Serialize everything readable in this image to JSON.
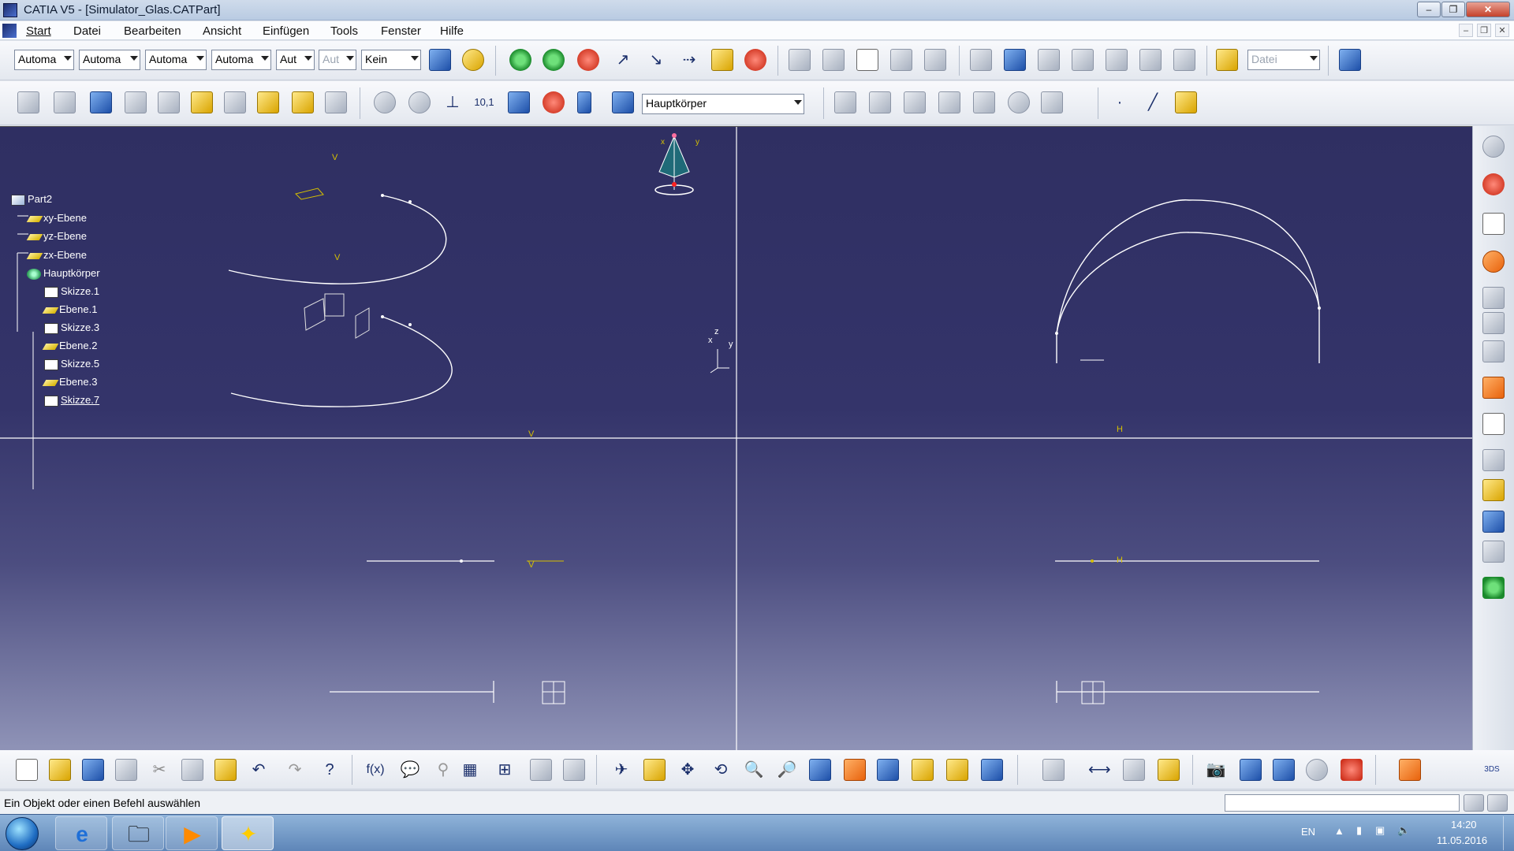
{
  "window": {
    "title": "CATIA V5 - [Simulator_Glas.CATPart]",
    "controls": [
      "–",
      "❐",
      "✕"
    ]
  },
  "menu": {
    "items": [
      "Start",
      "Datei",
      "Bearbeiten",
      "Ansicht",
      "Einfügen",
      "Tools",
      "Fenster",
      "Hilfe"
    ]
  },
  "toolbar1": {
    "combos": [
      "Automa",
      "Automa",
      "Automa",
      "Automa",
      "Aut",
      "Aut",
      "Kein"
    ],
    "file_combo": "Datei"
  },
  "toolbar2": {
    "body_combo": "Hauptkörper"
  },
  "tree": {
    "root": "Part2",
    "items": [
      "xy-Ebene",
      "yz-Ebene",
      "zx-Ebene",
      "Hauptkörper",
      "Skizze.1",
      "Ebene.1",
      "Skizze.3",
      "Ebene.2",
      "Skizze.5",
      "Ebene.3",
      "Skizze.7"
    ]
  },
  "viewport": {
    "axis_z": "z",
    "axis_x": "x",
    "axis_y": "y",
    "compass_x": "x",
    "compass_y": "y",
    "sketch_axis_v": "V",
    "sketch_axis_h": "H"
  },
  "status": {
    "message": "Ein Objekt oder einen Befehl auswählen"
  },
  "taskbar": {
    "lang": "EN",
    "time": "14:20",
    "date": "11.05.2016"
  },
  "colors": {
    "viewport_top": "#2f2f62",
    "viewport_bottom": "#8f93b7",
    "geometry": "#ffffff",
    "sketch_marker": "#d6c000"
  }
}
